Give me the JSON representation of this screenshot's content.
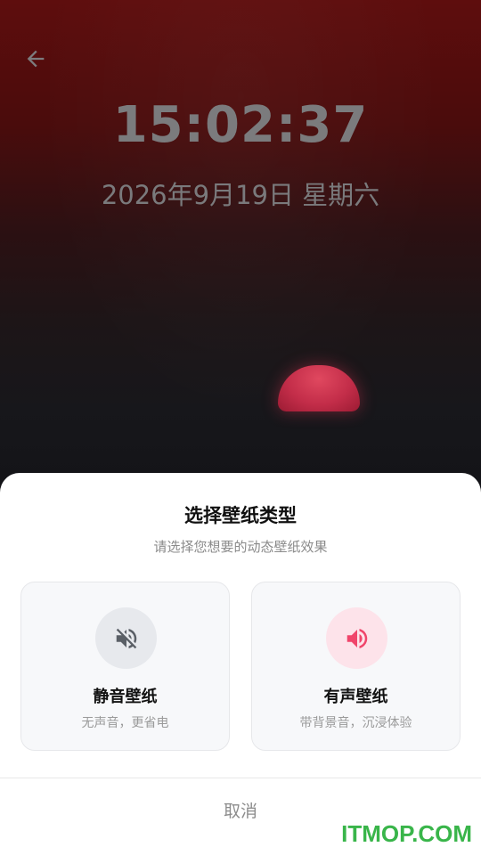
{
  "wallpaper": {
    "time": "15:02:37",
    "date": "2026年9月19日 星期六"
  },
  "navigation": {
    "back_icon": "arrow-left-icon"
  },
  "dialog": {
    "title": "选择壁纸类型",
    "subtitle": "请选择您想要的动态壁纸效果",
    "options": [
      {
        "label": "静音壁纸",
        "description": "无声音，更省电",
        "icon": "volume-mute-icon",
        "icon_color": "#5a5f66"
      },
      {
        "label": "有声壁纸",
        "description": "带背景音，沉浸体验",
        "icon": "volume-up-icon",
        "icon_color": "#f0456b"
      }
    ],
    "cancel_label": "取消"
  },
  "watermark": "ITMOP.COM",
  "colors": {
    "accent": "#f0456b",
    "watermark": "#39b54a"
  }
}
